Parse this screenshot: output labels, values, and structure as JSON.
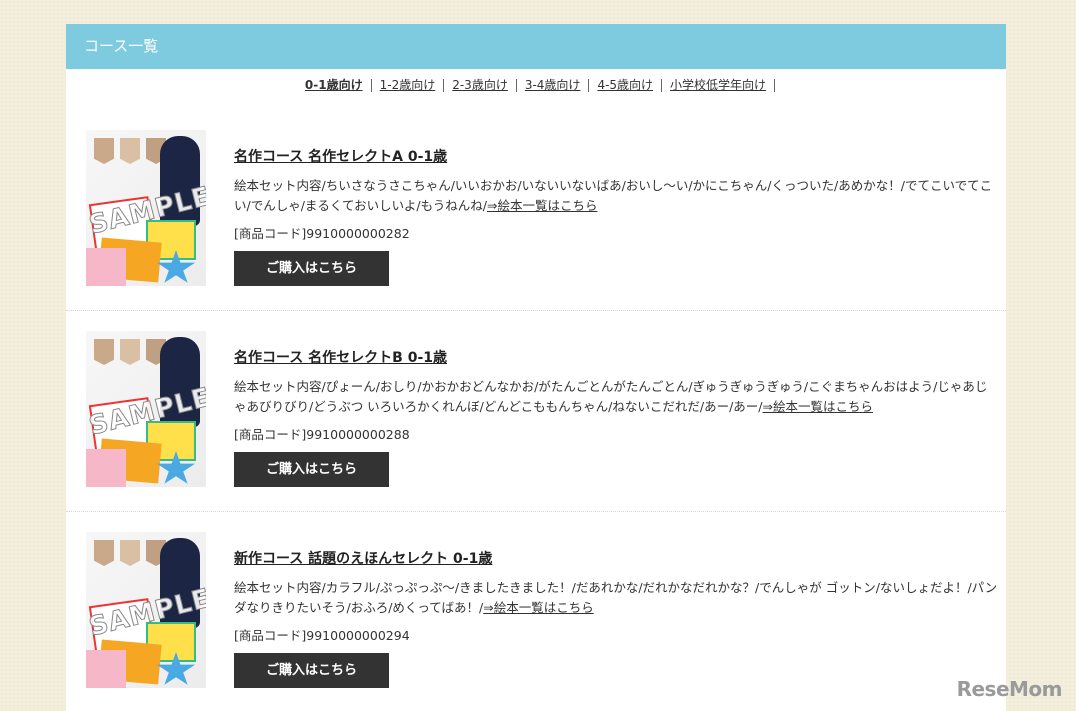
{
  "header": {
    "title": "コース一覧"
  },
  "age_tabs": [
    {
      "label": "0-1歳向け",
      "active": true
    },
    {
      "label": "1-2歳向け",
      "active": false
    },
    {
      "label": "2-3歳向け",
      "active": false
    },
    {
      "label": "3-4歳向け",
      "active": false
    },
    {
      "label": "4-5歳向け",
      "active": false
    },
    {
      "label": "小学校低学年向け",
      "active": false
    }
  ],
  "courses": [
    {
      "title": "名作コース 名作セレクトA 0-1歳",
      "description": "絵本セット内容/ちいさなうさこちゃん/いいおかお/いないいないばあ/おいし～い/かにこちゃん/くっついた/あめかな！/でてこいでてこい/でんしゃ/まるくておいしいよ/もうねんね/",
      "more_link": "⇒絵本一覧はこちら",
      "code": "[商品コード]9910000000282",
      "buy_label": "ご購入はこちら",
      "sample_label": "SAMPLE"
    },
    {
      "title": "名作コース 名作セレクトB 0-1歳",
      "description": "絵本セット内容/ぴょーん/おしり/かおかおどんなかお/がたんごとんがたんごとん/ぎゅうぎゅうぎゅう/こぐまちゃんおはよう/じゃあじゃあびりびり/どうぶつ いろいろかくれんぼ/どんどこももんちゃん/ねないこだれだ/あー/あー/",
      "more_link": "⇒絵本一覧はこちら",
      "code": "[商品コード]9910000000288",
      "buy_label": "ご購入はこちら",
      "sample_label": "SAMPLE"
    },
    {
      "title": "新作コース 話題のえほんセレクト 0-1歳",
      "description": "絵本セット内容/カラフル/ぷっぷっぷ～/きましたきました！/だあれかな/だれかなだれかな？/でんしゃが ゴットン/ないしょだよ！/パンダなりきりたいそう/おふろ/めくってばあ！/",
      "more_link": "⇒絵本一覧はこちら",
      "code": "[商品コード]9910000000294",
      "buy_label": "ご購入はこちら",
      "sample_label": "SAMPLE"
    }
  ],
  "watermark": "ReseMom"
}
